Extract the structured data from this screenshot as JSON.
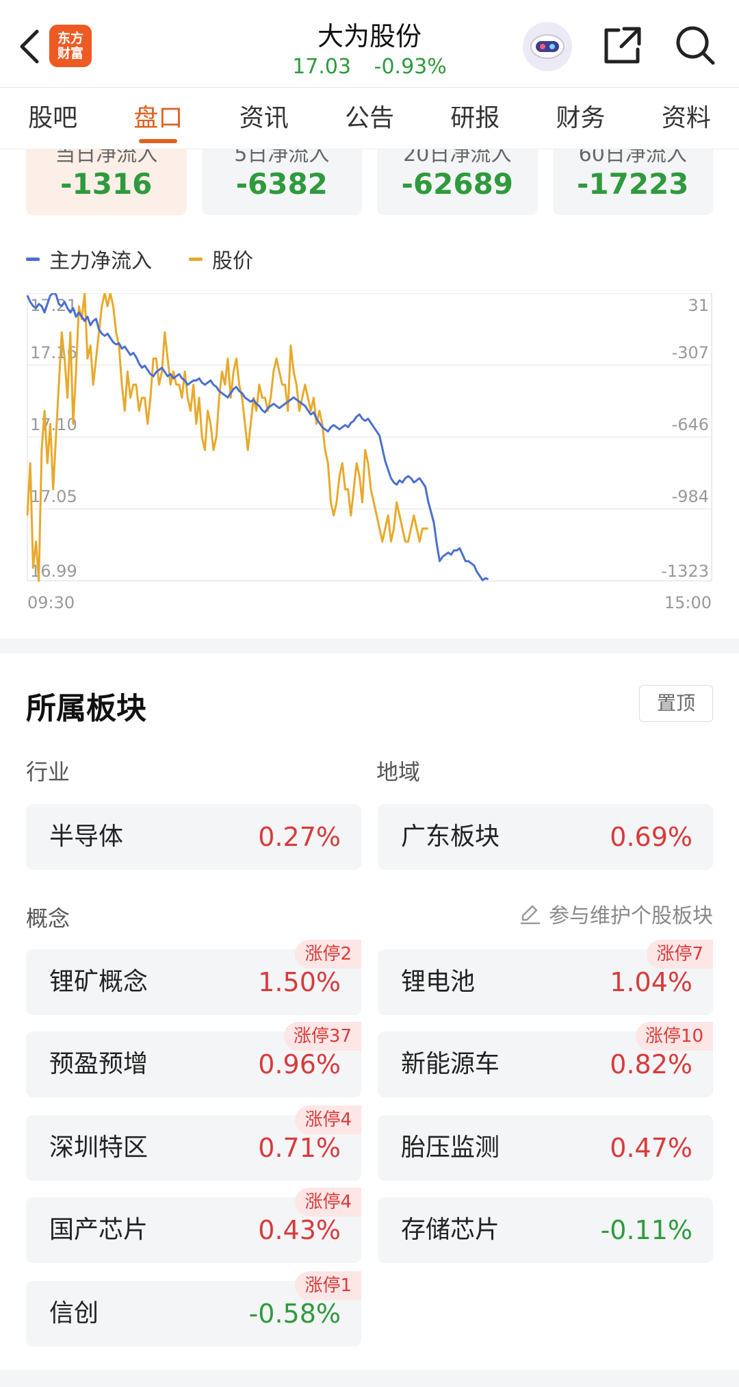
{
  "header": {
    "logo_line1": "东方",
    "logo_line2": "财富",
    "stock_name": "大为股份",
    "price": "17.03",
    "change_pct": "-0.93%"
  },
  "tabs": [
    "股吧",
    "盘口",
    "资讯",
    "公告",
    "研报",
    "财务",
    "资料"
  ],
  "active_tab": "盘口",
  "flows": [
    {
      "label": "当日净流入",
      "value": "-1316"
    },
    {
      "label": "5日净流入",
      "value": "-6382"
    },
    {
      "label": "20日净流入",
      "value": "-62689"
    },
    {
      "label": "60日净流入",
      "value": "-17223"
    }
  ],
  "chart_data": {
    "type": "line",
    "legend": [
      {
        "name": "主力净流入",
        "color": "#4a6fd0"
      },
      {
        "name": "股价",
        "color": "#e8a92a"
      }
    ],
    "x_start": "09:30",
    "x_end": "15:00",
    "left_ticks": [
      "17.21",
      "17.16",
      "17.10",
      "17.05",
      "16.99"
    ],
    "right_ticks": [
      "31",
      "-307",
      "-646",
      "-984",
      "-1323"
    ],
    "ylim_left": [
      16.99,
      17.21
    ],
    "ylim_right": [
      -1323,
      31
    ],
    "x_points": 240,
    "series": [
      {
        "name": "主力净流入",
        "axis": "right",
        "values": [
          20,
          -10,
          -30,
          -40,
          -20,
          -30,
          -60,
          -20,
          20,
          31,
          25,
          -20,
          -30,
          -10,
          -40,
          -60,
          -40,
          -80,
          -60,
          -80,
          -100,
          -80,
          -120,
          -100,
          -90,
          -140,
          -160,
          -170,
          -160,
          -180,
          -200,
          -210,
          -205,
          -230,
          -220,
          -240,
          -260,
          -250,
          -270,
          -300,
          -320,
          -310,
          -330,
          -350,
          -360,
          -340,
          -330,
          -320,
          -340,
          -360,
          -350,
          -370,
          -360,
          -350,
          -370,
          -380,
          -400,
          -390,
          -380,
          -380,
          -370,
          -390,
          -400,
          -390,
          -380,
          -400,
          -410,
          -430,
          -440,
          -450,
          -460,
          -440,
          -420,
          -410,
          -430,
          -440,
          -460,
          -470,
          -480,
          -470,
          -490,
          -500,
          -520,
          -530,
          -510,
          -500,
          -490,
          -500,
          -510,
          -500,
          -490,
          -480,
          -470,
          -460,
          -470,
          -480,
          -490,
          -500,
          -520,
          -540,
          -530,
          -560,
          -580,
          -600,
          -610,
          -620,
          -600,
          -590,
          -600,
          -610,
          -600,
          -590,
          -600,
          -580,
          -570,
          -550,
          -540,
          -560,
          -570,
          -560,
          -580,
          -600,
          -620,
          -640,
          -700,
          -760,
          -800,
          -840,
          -860,
          -870,
          -850,
          -860,
          -840,
          -830,
          -840,
          -860,
          -850,
          -840,
          -860,
          -880,
          -950,
          -1000,
          -1050,
          -1150,
          -1230,
          -1210,
          -1200,
          -1190,
          -1200,
          -1180,
          -1180,
          -1170,
          -1200,
          -1230,
          -1230,
          -1240,
          -1250,
          -1280,
          -1300,
          -1320,
          -1310,
          -1316
        ]
      },
      {
        "name": "股价",
        "axis": "left",
        "values": [
          17.04,
          17.08,
          17.0,
          17.02,
          16.99,
          17.09,
          17.12,
          17.08,
          17.11,
          17.06,
          17.1,
          17.14,
          17.18,
          17.16,
          17.13,
          17.18,
          17.11,
          17.15,
          17.2,
          17.19,
          17.21,
          17.16,
          17.17,
          17.14,
          17.16,
          17.18,
          17.2,
          17.21,
          17.2,
          17.21,
          17.2,
          17.18,
          17.17,
          17.14,
          17.12,
          17.15,
          17.13,
          17.14,
          17.14,
          17.12,
          17.13,
          17.13,
          17.11,
          17.13,
          17.16,
          17.16,
          17.14,
          17.15,
          17.18,
          17.16,
          17.14,
          17.15,
          17.14,
          17.14,
          17.13,
          17.15,
          17.13,
          17.12,
          17.14,
          17.11,
          17.13,
          17.1,
          17.09,
          17.12,
          17.11,
          17.09,
          17.1,
          17.13,
          17.15,
          17.14,
          17.16,
          17.13,
          17.15,
          17.16,
          17.14,
          17.13,
          17.11,
          17.09,
          17.11,
          17.13,
          17.12,
          17.14,
          17.13,
          17.13,
          17.12,
          17.13,
          17.15,
          17.16,
          17.15,
          17.14,
          17.14,
          17.12,
          17.17,
          17.15,
          17.14,
          17.12,
          17.13,
          17.14,
          17.13,
          17.12,
          17.13,
          17.11,
          17.12,
          17.11,
          17.09,
          17.08,
          17.05,
          17.04,
          17.05,
          17.07,
          17.08,
          17.06,
          17.06,
          17.04,
          17.06,
          17.08,
          17.07,
          17.05,
          17.09,
          17.08,
          17.06,
          17.05,
          17.04,
          17.03,
          17.02,
          17.03,
          17.04,
          17.02,
          17.03,
          17.05,
          17.04,
          17.03,
          17.02,
          17.02,
          17.03,
          17.04,
          17.03,
          17.02,
          17.03,
          17.03,
          17.03
        ]
      }
    ]
  },
  "sectors": {
    "title": "所属板块",
    "pin_label": "置顶",
    "industry_label": "行业",
    "region_label": "地域",
    "industry": {
      "name": "半导体",
      "pct": "0.27%"
    },
    "region": {
      "name": "广东板块",
      "pct": "0.69%"
    },
    "concept_label": "概念",
    "maintain_label": "参与维护个股板块",
    "concepts": [
      {
        "name": "锂矿概念",
        "pct": "1.50%",
        "tag": "涨停2"
      },
      {
        "name": "锂电池",
        "pct": "1.04%",
        "tag": "涨停7"
      },
      {
        "name": "预盈预增",
        "pct": "0.96%",
        "tag": "涨停37"
      },
      {
        "name": "新能源车",
        "pct": "0.82%",
        "tag": "涨停10"
      },
      {
        "name": "深圳特区",
        "pct": "0.71%",
        "tag": "涨停4"
      },
      {
        "name": "胎压监测",
        "pct": "0.47%",
        "tag": ""
      },
      {
        "name": "国产芯片",
        "pct": "0.43%",
        "tag": "涨停4"
      },
      {
        "name": "存储芯片",
        "pct": "-0.11%",
        "tag": ""
      },
      {
        "name": "信创",
        "pct": "-0.58%",
        "tag": "涨停1"
      }
    ]
  }
}
